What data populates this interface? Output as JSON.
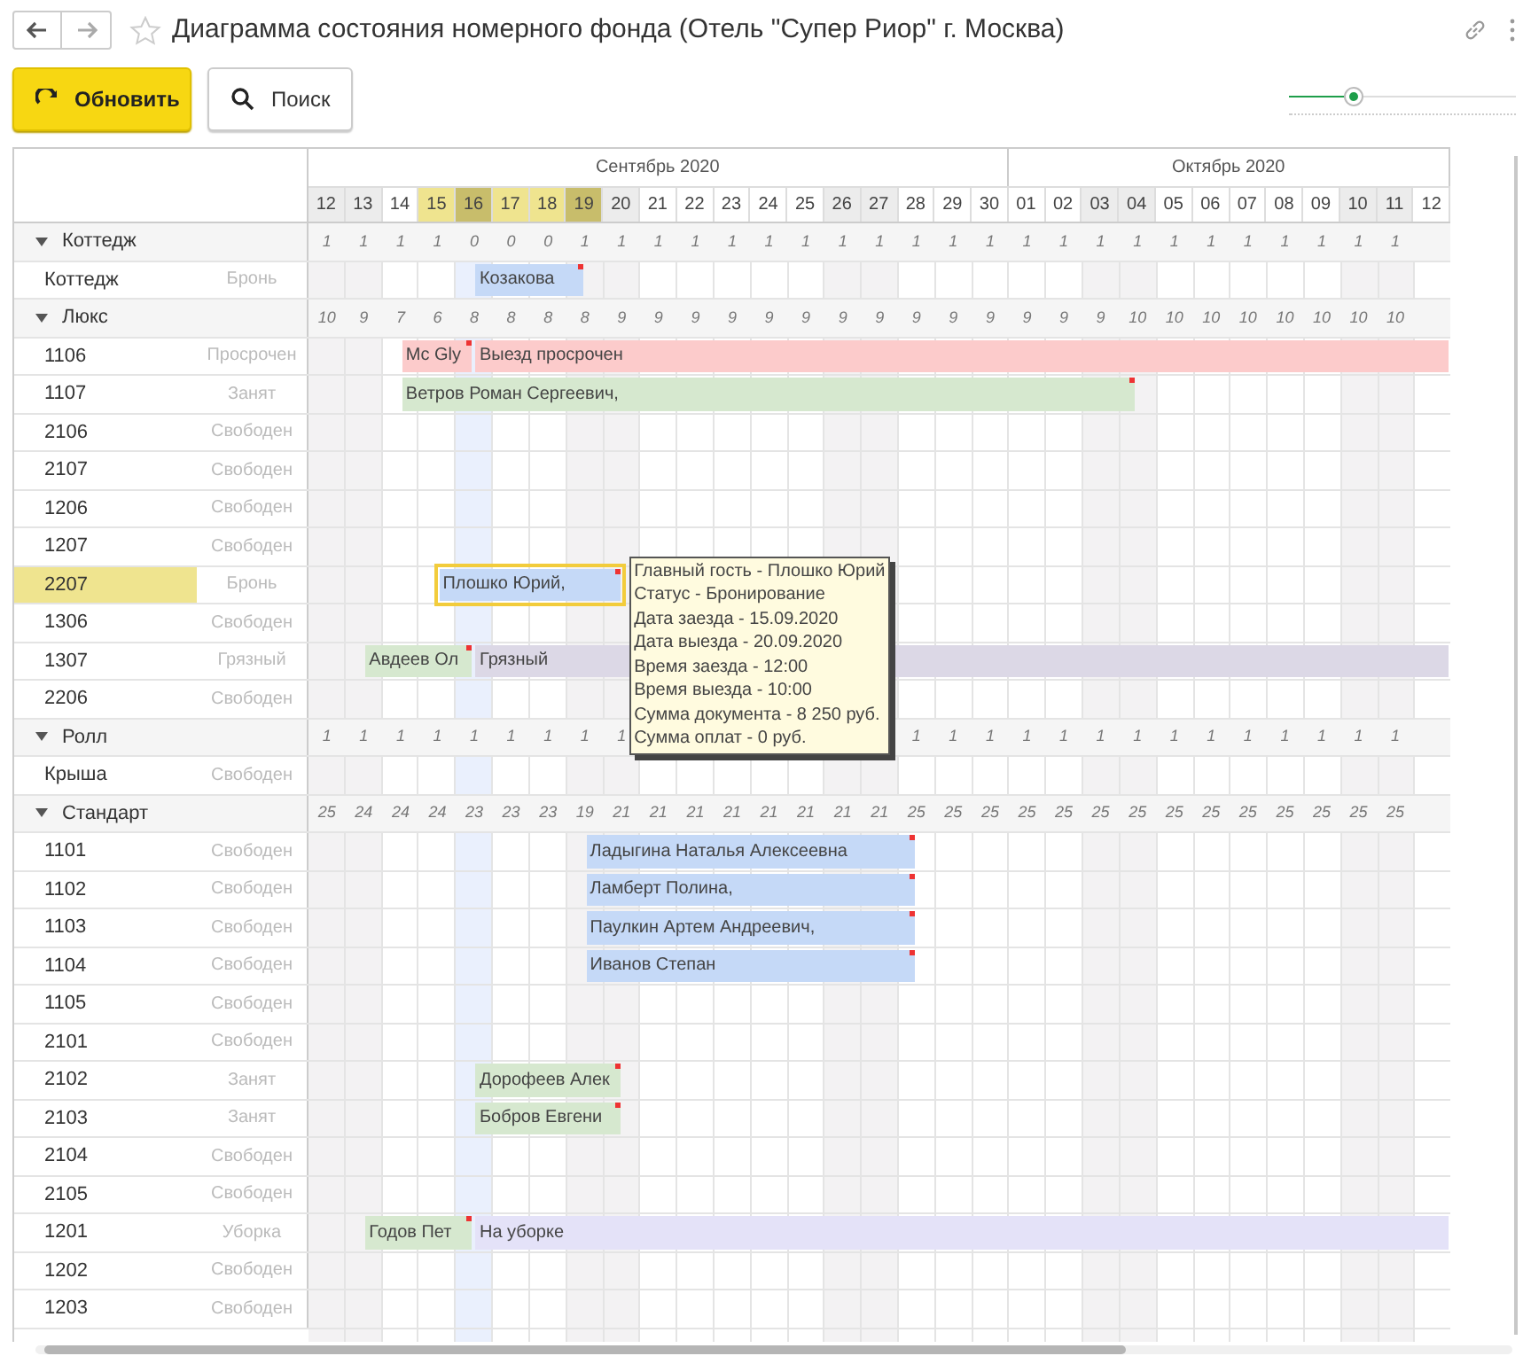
{
  "window": {
    "title": "Диаграмма состояния номерного фонда (Отель \"Супер Риор\" г. Москва)"
  },
  "toolbar": [
    {
      "label": "Обновить",
      "kind": "refresh",
      "default": true
    },
    {
      "label": "Поиск",
      "kind": "search",
      "default": false
    }
  ],
  "zoom_slider": {
    "level": 0.28
  },
  "calendar": {
    "months": [
      {
        "label": "Сентябрь 2020",
        "days": [
          {
            "label": "12",
            "weekend": true,
            "selected": false,
            "today": false
          },
          {
            "label": "13",
            "weekend": true,
            "selected": false,
            "today": false
          },
          {
            "label": "14",
            "weekend": false,
            "selected": false,
            "today": false
          },
          {
            "label": "15",
            "weekend": false,
            "selected": true,
            "today": false
          },
          {
            "label": "16",
            "weekend": false,
            "selected": true,
            "today": true
          },
          {
            "label": "17",
            "weekend": false,
            "selected": true,
            "today": false
          },
          {
            "label": "18",
            "weekend": false,
            "selected": true,
            "today": false
          },
          {
            "label": "19",
            "weekend": true,
            "selected": true,
            "today": false
          },
          {
            "label": "20",
            "weekend": true,
            "selected": false,
            "today": false
          },
          {
            "label": "21",
            "weekend": false,
            "selected": false,
            "today": false
          },
          {
            "label": "22",
            "weekend": false,
            "selected": false,
            "today": false
          },
          {
            "label": "23",
            "weekend": false,
            "selected": false,
            "today": false
          },
          {
            "label": "24",
            "weekend": false,
            "selected": false,
            "today": false
          },
          {
            "label": "25",
            "weekend": false,
            "selected": false,
            "today": false
          },
          {
            "label": "26",
            "weekend": true,
            "selected": false,
            "today": false
          },
          {
            "label": "27",
            "weekend": true,
            "selected": false,
            "today": false
          },
          {
            "label": "28",
            "weekend": false,
            "selected": false,
            "today": false
          },
          {
            "label": "29",
            "weekend": false,
            "selected": false,
            "today": false
          },
          {
            "label": "30",
            "weekend": false,
            "selected": false,
            "today": false
          }
        ]
      },
      {
        "label": "Октябрь 2020",
        "days": [
          {
            "label": "01",
            "weekend": false,
            "selected": false,
            "today": false
          },
          {
            "label": "02",
            "weekend": false,
            "selected": false,
            "today": false
          },
          {
            "label": "03",
            "weekend": true,
            "selected": false,
            "today": false
          },
          {
            "label": "04",
            "weekend": true,
            "selected": false,
            "today": false
          },
          {
            "label": "05",
            "weekend": false,
            "selected": false,
            "today": false
          },
          {
            "label": "06",
            "weekend": false,
            "selected": false,
            "today": false
          },
          {
            "label": "07",
            "weekend": false,
            "selected": false,
            "today": false
          },
          {
            "label": "08",
            "weekend": false,
            "selected": false,
            "today": false
          },
          {
            "label": "09",
            "weekend": false,
            "selected": false,
            "today": false
          },
          {
            "label": "10",
            "weekend": true,
            "selected": false,
            "today": false
          },
          {
            "label": "11",
            "weekend": true,
            "selected": false,
            "today": false
          },
          {
            "label": "12",
            "weekend": false,
            "selected": false,
            "today": false
          }
        ]
      }
    ]
  },
  "groups": [
    {
      "name": "Коттедж",
      "expanded": true,
      "counts": [
        "1",
        "1",
        "1",
        "1",
        "0",
        "0",
        "0",
        "1",
        "1",
        "1",
        "1",
        "1",
        "1",
        "1",
        "1",
        "1",
        "1",
        "1",
        "1",
        "1",
        "1",
        "1",
        "1",
        "1",
        "1",
        "1",
        "1",
        "1",
        "1",
        "1"
      ],
      "rooms": [
        {
          "number": "Коттедж",
          "status": "Бронь",
          "selected": false,
          "bookings": [
            {
              "text": "Козакова",
              "kind": "reserved",
              "nights": [
                false,
                false,
                false,
                false,
                true,
                true,
                true
              ],
              "flag": true,
              "selected": false
            }
          ]
        }
      ]
    },
    {
      "name": "Люкс",
      "expanded": true,
      "counts": [
        "10",
        "9",
        "7",
        "6",
        "8",
        "8",
        "8",
        "8",
        "9",
        "9",
        "9",
        "9",
        "9",
        "9",
        "9",
        "9",
        "9",
        "9",
        "9",
        "9",
        "9",
        "9",
        "10",
        "10",
        "10",
        "10",
        "10",
        "10",
        "10",
        "10"
      ],
      "rooms": [
        {
          "number": "1106",
          "status": "Просрочен",
          "selected": false,
          "bookings": [
            {
              "text": "Mc Gly",
              "kind": "overdue",
              "nights": [
                false,
                false,
                true,
                true
              ],
              "flag": true,
              "selected": false
            },
            {
              "text": "Выезд просрочен",
              "kind": "overdue",
              "nights": [
                false,
                false,
                false,
                false,
                true,
                true,
                true,
                true,
                true,
                true,
                true,
                true,
                true,
                true,
                true,
                true,
                true,
                true,
                true,
                true,
                true,
                true,
                true,
                true,
                true,
                true,
                true,
                true,
                true,
                true,
                true
              ],
              "flag": false,
              "selected": false
            }
          ]
        },
        {
          "number": "1107",
          "status": "Занят",
          "selected": false,
          "bookings": [
            {
              "text": "Ветров Роман Сергеевич,",
              "kind": "occupied",
              "nights": [
                false,
                false,
                true,
                true,
                true,
                true,
                true,
                true,
                true,
                true,
                true,
                true,
                true,
                true,
                true,
                true,
                true,
                true,
                true,
                true,
                true,
                true
              ],
              "flag": true,
              "selected": false
            }
          ]
        },
        {
          "number": "2106",
          "status": "Свободен",
          "selected": false
        },
        {
          "number": "2107",
          "status": "Свободен",
          "selected": false
        },
        {
          "number": "1206",
          "status": "Свободен",
          "selected": false
        },
        {
          "number": "1207",
          "status": "Свободен",
          "selected": false
        },
        {
          "number": "2207",
          "status": "Бронь",
          "selected": true,
          "bookings": [
            {
              "text": "Плошко Юрий,",
              "kind": "reserved",
              "nights": [
                false,
                false,
                false,
                true,
                true,
                true,
                true,
                true
              ],
              "flag": true,
              "selected": true,
              "tooltip": [
                "Главный гость - Плошко Юрий",
                "Статус - Бронирование",
                "Дата заезда - 15.09.2020",
                "Дата выезда - 20.09.2020",
                "Время заезда - 12:00",
                "Время выезда - 10:00",
                "Сумма документа - 8 250 руб.",
                "Сумма оплат - 0 руб."
              ]
            }
          ]
        },
        {
          "number": "1306",
          "status": "Свободен",
          "selected": false
        },
        {
          "number": "1307",
          "status": "Грязный",
          "selected": false,
          "bookings": [
            {
              "text": "Авдеев Ол",
              "kind": "occupied",
              "nights": [
                false,
                true,
                true,
                true
              ],
              "flag": true,
              "selected": false
            },
            {
              "text": "Грязный",
              "kind": "dirty",
              "nights": [
                false,
                false,
                false,
                false,
                true,
                true,
                true,
                true,
                true,
                true,
                true,
                true,
                true,
                true,
                true,
                true,
                true,
                true,
                true,
                true,
                true,
                true,
                true,
                true,
                true,
                true,
                true,
                true,
                true,
                true,
                true
              ],
              "flag": false,
              "selected": false
            }
          ]
        },
        {
          "number": "2206",
          "status": "Свободен",
          "selected": false
        }
      ]
    },
    {
      "name": "Ролл",
      "expanded": true,
      "counts": [
        "1",
        "1",
        "1",
        "1",
        "1",
        "1",
        "1",
        "1",
        "1"
      ],
      "counts_after_tooltip": [
        "1",
        "1",
        "1",
        "1",
        "1",
        "1",
        "1",
        "1",
        "1",
        "1",
        "1",
        "1",
        "1",
        "1"
      ],
      "rooms": [
        {
          "number": "Крыша",
          "status": "Свободен",
          "selected": false
        }
      ]
    },
    {
      "name": "Стандарт",
      "expanded": true,
      "counts": [
        "25",
        "24",
        "24",
        "24",
        "23",
        "23",
        "23",
        "19",
        "21",
        "21",
        "21",
        "21",
        "21",
        "21",
        "21",
        "21",
        "25",
        "25",
        "25",
        "25",
        "25",
        "25",
        "25",
        "25",
        "25",
        "25",
        "25",
        "25",
        "25",
        "25"
      ],
      "rooms": [
        {
          "number": "1101",
          "status": "Свободен",
          "selected": false,
          "bookings": [
            {
              "text": "Ладыгина Наталья Алексеевна",
              "kind": "reserved",
              "nights": [
                false,
                false,
                false,
                false,
                false,
                false,
                false,
                true,
                true,
                true,
                true,
                true,
                true,
                true,
                true,
                true
              ],
              "flag": true,
              "selected": false
            }
          ]
        },
        {
          "number": "1102",
          "status": "Свободен",
          "selected": false,
          "bookings": [
            {
              "text": "Ламберт Полина,",
              "kind": "reserved",
              "nights": [
                false,
                false,
                false,
                false,
                false,
                false,
                false,
                true,
                true,
                true,
                true,
                true,
                true,
                true,
                true,
                true
              ],
              "flag": true,
              "selected": false
            }
          ]
        },
        {
          "number": "1103",
          "status": "Свободен",
          "selected": false,
          "bookings": [
            {
              "text": "Паулкин Артем Андреевич,",
              "kind": "reserved",
              "nights": [
                false,
                false,
                false,
                false,
                false,
                false,
                false,
                true,
                true,
                true,
                true,
                true,
                true,
                true,
                true,
                true
              ],
              "flag": true,
              "selected": false
            }
          ]
        },
        {
          "number": "1104",
          "status": "Свободен",
          "selected": false,
          "bookings": [
            {
              "text": "Иванов Степан",
              "kind": "reserved",
              "nights": [
                false,
                false,
                false,
                false,
                false,
                false,
                false,
                true,
                true,
                true,
                true,
                true,
                true,
                true,
                true,
                true
              ],
              "flag": true,
              "selected": false
            }
          ]
        },
        {
          "number": "1105",
          "status": "Свободен",
          "selected": false
        },
        {
          "number": "2101",
          "status": "Свободен",
          "selected": false
        },
        {
          "number": "2102",
          "status": "Занят",
          "selected": false,
          "bookings": [
            {
              "text": "Дорофеев Алек",
              "kind": "occupied",
              "nights": [
                false,
                false,
                false,
                false,
                true,
                true,
                true,
                true
              ],
              "flag": true,
              "selected": false
            }
          ]
        },
        {
          "number": "2103",
          "status": "Занят",
          "selected": false,
          "bookings": [
            {
              "text": "Бобров Евгени",
              "kind": "occupied",
              "nights": [
                false,
                false,
                false,
                false,
                true,
                true,
                true,
                true
              ],
              "flag": true,
              "selected": false
            }
          ]
        },
        {
          "number": "2104",
          "status": "Свободен",
          "selected": false
        },
        {
          "number": "2105",
          "status": "Свободен",
          "selected": false
        },
        {
          "number": "1201",
          "status": "Уборка",
          "selected": false,
          "bookings": [
            {
              "text": "Годов Пет",
              "kind": "occupied",
              "nights": [
                false,
                true,
                true,
                true
              ],
              "flag": true,
              "selected": false
            },
            {
              "text": "На уборке",
              "kind": "cleaning",
              "nights": [
                false,
                false,
                false,
                false,
                true,
                true,
                true,
                true,
                true,
                true,
                true,
                true,
                true,
                true,
                true,
                true,
                true,
                true,
                true,
                true,
                true,
                true,
                true,
                true,
                true,
                true,
                true,
                true,
                true,
                true,
                true
              ],
              "flag": false,
              "selected": false
            }
          ]
        },
        {
          "number": "1202",
          "status": "Свободен",
          "selected": false
        },
        {
          "number": "1203",
          "status": "Свободен",
          "selected": false
        }
      ]
    }
  ]
}
